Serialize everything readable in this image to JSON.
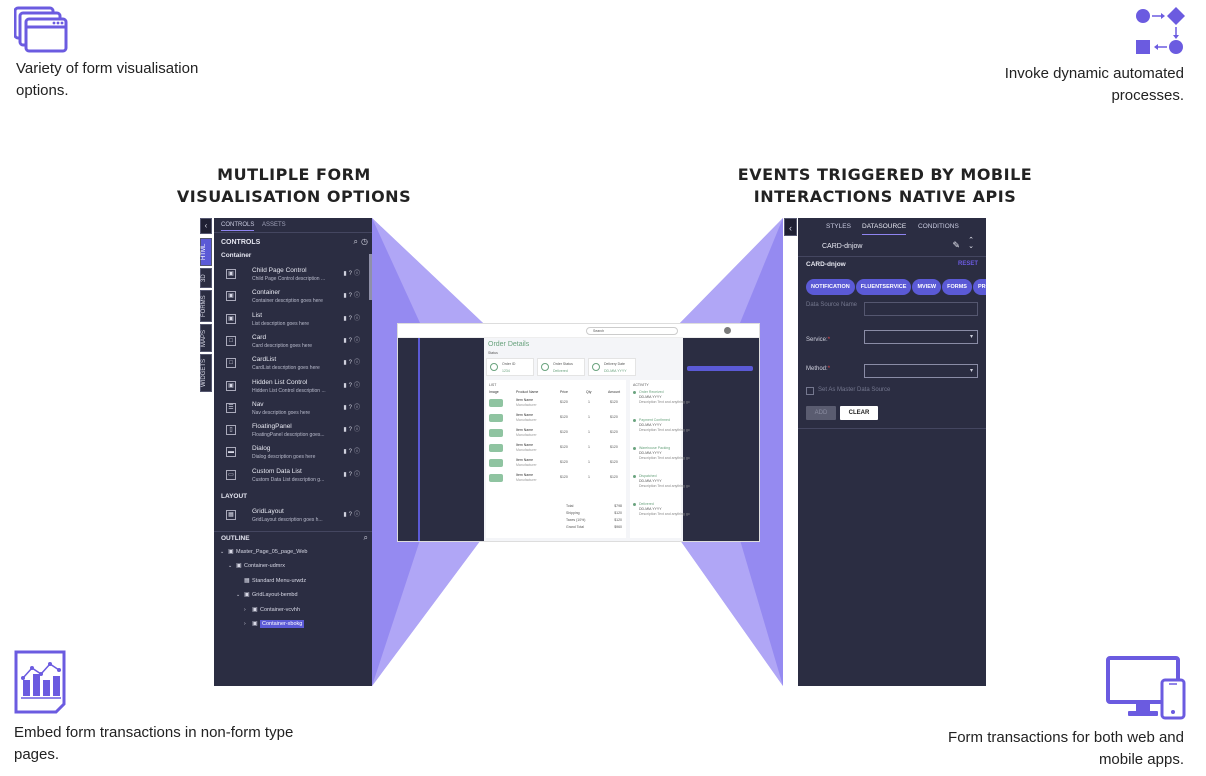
{
  "features": {
    "top_left": {
      "icon": "windows-stack-icon",
      "text": "Variety of form visualisation options."
    },
    "top_right": {
      "icon": "process-flow-icon",
      "text": "Invoke dynamic automated processes."
    },
    "bottom_left": {
      "icon": "chart-document-icon",
      "text": "Embed form transactions in non-form type pages."
    },
    "bottom_right": {
      "icon": "desktop-mobile-icon",
      "text": "Form transactions for both web and mobile apps."
    }
  },
  "headings": {
    "left_line1": "MUTLIPLE FORM",
    "left_line2": "VISUALISATION OPTIONS",
    "right_line1": "EVENTS TRIGGERED BY MOBILE",
    "right_line2": "INTERACTIONS NATIVE APIS"
  },
  "colors": {
    "accent": "#6b5be0",
    "panel": "#2b2d42",
    "beam": "#8f84f0",
    "chip": "#5b5ad6"
  },
  "left_panel": {
    "tabs": [
      "CONTROLS",
      "ASSETS"
    ],
    "side_tabs": [
      "HTML",
      "3D",
      "FORMS",
      "MAPS",
      "WIDGETS"
    ],
    "section_title": "CONTROLS",
    "group_container": "Container",
    "controls": [
      {
        "name": "Child Page Control",
        "desc": "Child Page Control description ..."
      },
      {
        "name": "Container",
        "desc": "Container description goes here"
      },
      {
        "name": "List",
        "desc": "List description goes here"
      },
      {
        "name": "Card",
        "desc": "Card description goes here"
      },
      {
        "name": "CardList",
        "desc": "CardList description goes here"
      },
      {
        "name": "Hidden List Control",
        "desc": "Hidden List Control description ..."
      },
      {
        "name": "Nav",
        "desc": "Nav description goes here"
      },
      {
        "name": "FloatingPanel",
        "desc": "FloatingPanel description goes..."
      },
      {
        "name": "Dialog",
        "desc": "Dialog description goes here"
      },
      {
        "name": "Custom Data List",
        "desc": "Custom Data List description g..."
      }
    ],
    "group_layout": "LAYOUT",
    "layout_controls": [
      {
        "name": "GridLayout",
        "desc": "GridLayout description goes h..."
      }
    ],
    "outline_title": "OUTLINE",
    "outline": [
      {
        "label": "Master_Page_05_page_Web",
        "depth": 0,
        "arrow": "v"
      },
      {
        "label": "Container-udmrx",
        "depth": 1,
        "arrow": "v"
      },
      {
        "label": "Standard Menu-urwdz",
        "depth": 2,
        "arrow": ""
      },
      {
        "label": "GridLayout-bembd",
        "depth": 2,
        "arrow": "v"
      },
      {
        "label": "Container-vcvhh",
        "depth": 3,
        "arrow": ">"
      },
      {
        "label": "Container-xbokg",
        "depth": 3,
        "arrow": ">",
        "selected": true
      }
    ]
  },
  "right_panel": {
    "tabs": [
      "STYLES",
      "DATASOURCE",
      "CONDITIONS"
    ],
    "active_tab": "DATASOURCE",
    "component": "CARD-dnjow",
    "section_title": "CARD-dnjow",
    "reset_label": "RESET",
    "chips": [
      "NOTIFICATION",
      "FLUENTSERVICE",
      "MVIEW",
      "FORMS",
      "PROCESS"
    ],
    "fields": [
      {
        "label": "Data Source Name",
        "value": "",
        "disabled": true
      },
      {
        "label": "Service:",
        "value": "",
        "required": true
      },
      {
        "label": "Method:",
        "value": "",
        "required": true
      }
    ],
    "checkbox_label": "Set As Master Data Source",
    "add_label": "ADD",
    "clear_label": "CLEAR"
  },
  "center_preview": {
    "search_placeholder": "Search",
    "page_title": "Order Details",
    "page_subtitle": "Status",
    "cards": [
      {
        "label": "Order ID",
        "value": "1234"
      },
      {
        "label": "Order Status",
        "value": "Delivered"
      },
      {
        "label": "Delivery Date",
        "value": "DD-MM-YYYY"
      }
    ],
    "list_title": "LIST",
    "columns": [
      "Image",
      "Product Name",
      "Price",
      "Qty",
      "Amount"
    ],
    "rows": [
      {
        "name": "Item Name",
        "sub": "Manufacturer",
        "price": "$120",
        "qty": "1",
        "amount": "$120"
      },
      {
        "name": "Item Name",
        "sub": "Manufacturer",
        "price": "$120",
        "qty": "1",
        "amount": "$120"
      },
      {
        "name": "Item Name",
        "sub": "Manufacturer",
        "price": "$120",
        "qty": "1",
        "amount": "$120"
      },
      {
        "name": "Item Name",
        "sub": "Manufacturer",
        "price": "$120",
        "qty": "1",
        "amount": "$120"
      },
      {
        "name": "Item Name",
        "sub": "Manufacturer",
        "price": "$120",
        "qty": "1",
        "amount": "$120"
      },
      {
        "name": "Item Name",
        "sub": "Manufacturer",
        "price": "$120",
        "qty": "1",
        "amount": "$120"
      }
    ],
    "totals": [
      {
        "label": "Total",
        "value": "$798"
      },
      {
        "label": "Shipping",
        "value": "$120"
      },
      {
        "label": "Taxes (10%)",
        "value": "$120"
      },
      {
        "label": "Grand Total",
        "value": "$960"
      }
    ],
    "activity_title": "ACTIVITY",
    "activity": [
      {
        "title": "Order Received",
        "date": "DD-MM-YYYY",
        "desc": "Description Text and anything go"
      },
      {
        "title": "Payment Confirmed",
        "date": "DD-MM-YYYY",
        "desc": "Description Text and anything go"
      },
      {
        "title": "Warehouse Packing",
        "date": "DD-MM-YYYY",
        "desc": "Description Text and anything go"
      },
      {
        "title": "Dispatched",
        "date": "DD-MM-YYYY",
        "desc": "Description Text and anything go"
      },
      {
        "title": "Delivered",
        "date": "DD-MM-YYYY",
        "desc": "Description Text and anything go"
      }
    ]
  }
}
